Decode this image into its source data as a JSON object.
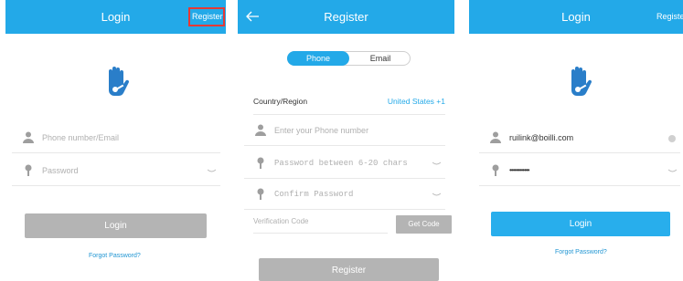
{
  "colors": {
    "header_blue": "#23a9e8",
    "button_grey": "#b4b4b4",
    "button_blue": "#28aeec",
    "link_blue": "#2196d3",
    "highlight_red": "#e53935"
  },
  "login": {
    "title": "Login",
    "register_link": "Register",
    "logo_icon": "hand-key-icon",
    "phone_email_placeholder": "Phone number/Email",
    "password_placeholder": "Password",
    "login_button": "Login",
    "forgot_password": "Forgot Password?"
  },
  "register": {
    "title": "Register",
    "back_icon": "arrow-left-icon",
    "tabs": {
      "phone": "Phone",
      "email": "Email",
      "selected": "Phone"
    },
    "country_label": "Country/Region",
    "country_value": "United States +1",
    "phone_placeholder": "Enter your Phone number",
    "password_placeholder": "Password between 6-20 chars",
    "confirm_placeholder": "Confirm Password",
    "code_placeholder": "Verification Code",
    "get_code_button": "Get Code",
    "register_button": "Register"
  },
  "login_filled": {
    "title": "Login",
    "register_link": "Registe",
    "email_value": "ruilink@boilli.com",
    "password_value": "••••••••••••",
    "login_button": "Login",
    "forgot_password": "Forgot Password?"
  }
}
